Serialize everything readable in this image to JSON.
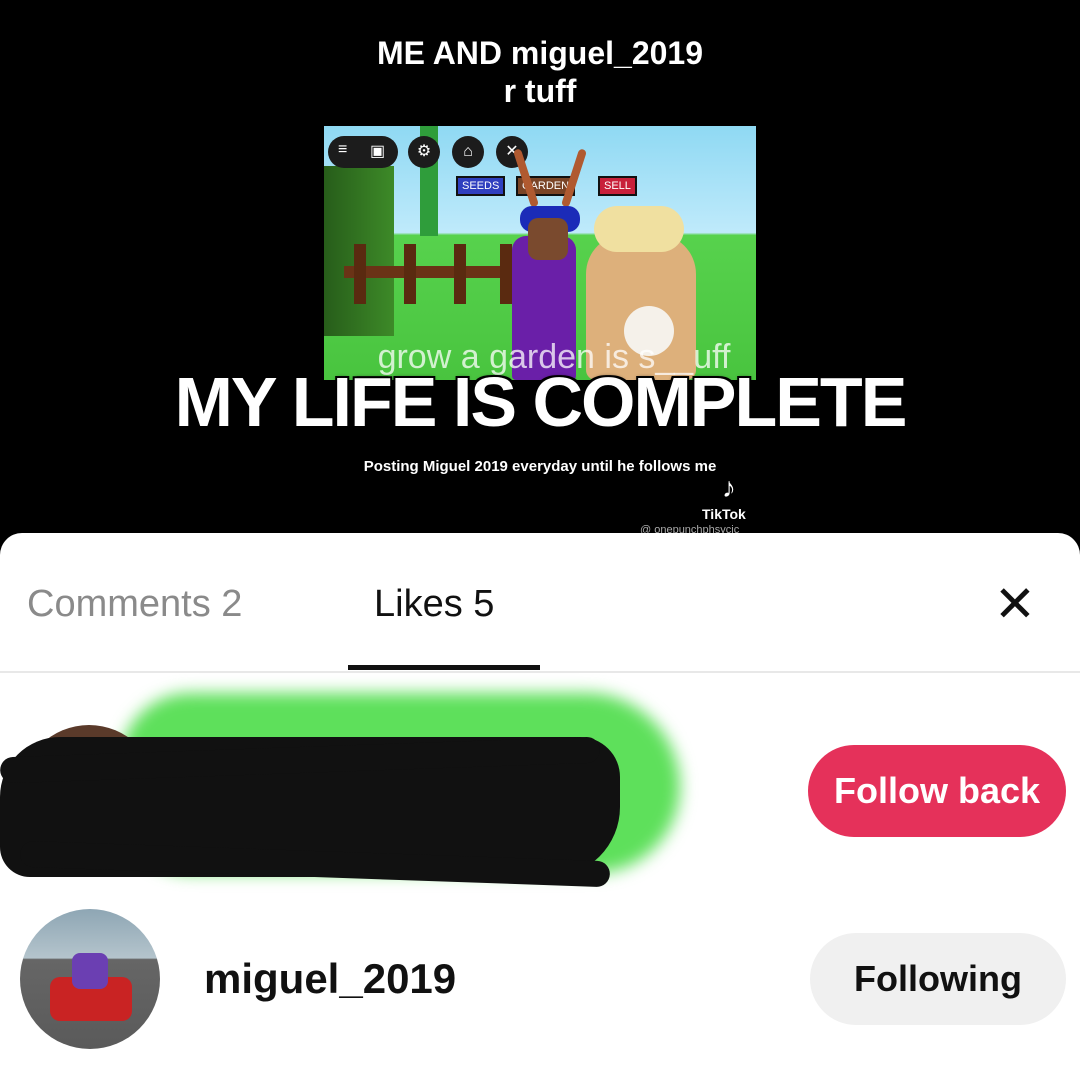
{
  "video": {
    "caption_line1": "ME AND miguel_2019",
    "caption_line2": "r tuff",
    "game_buttons": [
      "SEEDS",
      "GARDEN",
      "SELL"
    ],
    "game_overlay_text": "grow a garden is s__uff",
    "overlay_title": "MY LIFE IS COMPLETE",
    "overlay_subtitle": "Posting Miguel 2019 everyday until he follows me",
    "watermark_brand": "TikTok",
    "watermark_handle": "@ onepunchphsycic"
  },
  "sheet": {
    "tabs": [
      {
        "label": "Comments 2",
        "active": false
      },
      {
        "label": "Likes 5",
        "active": true
      }
    ],
    "close_icon": "close-icon",
    "likes": [
      {
        "username": "",
        "button_label": "Follow back",
        "button_color": "#e5315a",
        "redacted": true
      },
      {
        "username": "miguel_2019",
        "button_label": "Following",
        "button_color": "#f0f0f0",
        "redacted": false
      }
    ]
  }
}
